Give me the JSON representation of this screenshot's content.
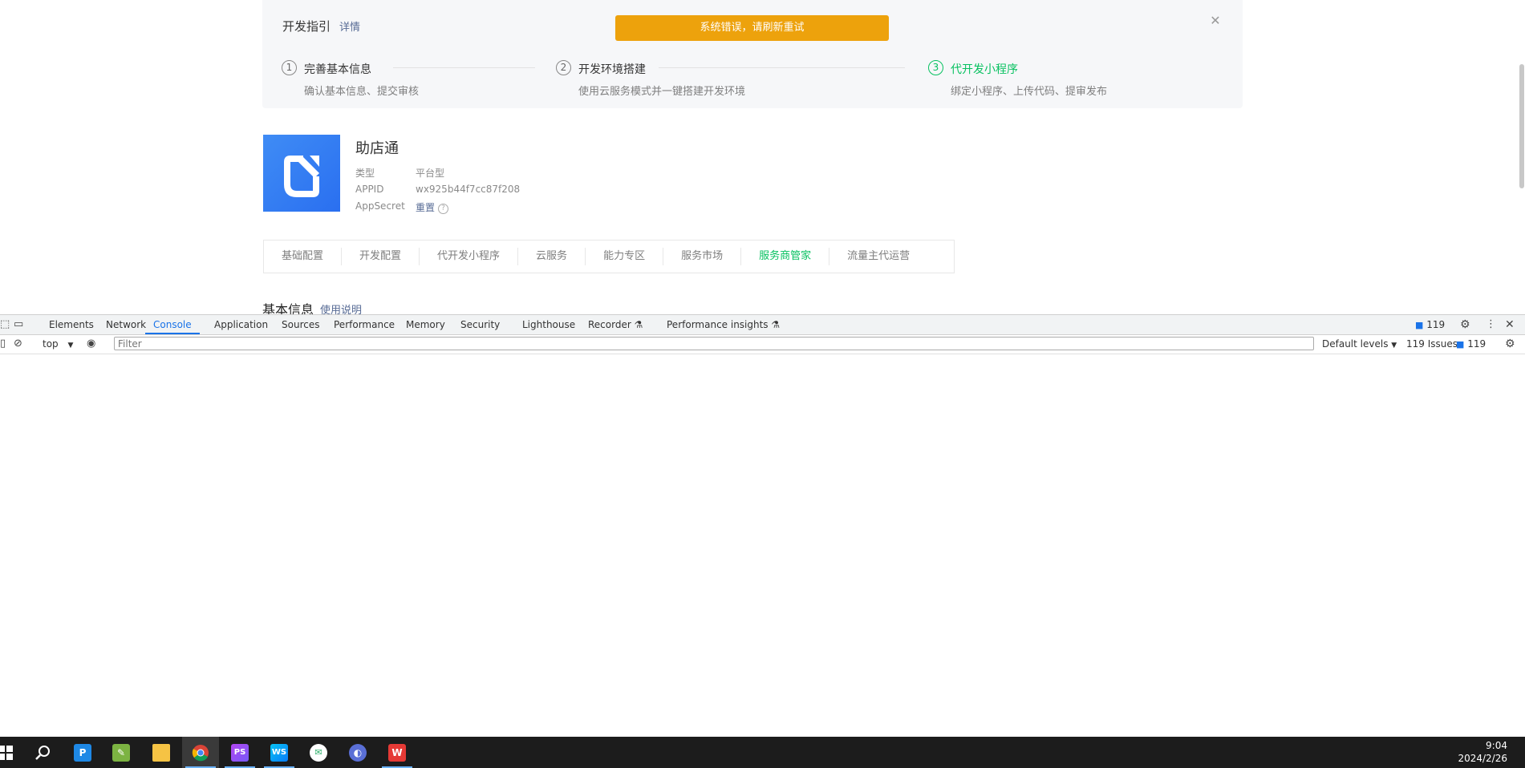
{
  "guide": {
    "title": "开发指引",
    "detail_link": "详情",
    "error_toast": "系统错误，请刷新重试",
    "close_icon": "close-icon",
    "steps": [
      {
        "num": "1",
        "title": "完善基本信息",
        "desc": "确认基本信息、提交审核"
      },
      {
        "num": "2",
        "title": "开发环境搭建",
        "desc": "使用云服务模式并一键搭建开发环境"
      },
      {
        "num": "3",
        "title": "代开发小程序",
        "desc": "绑定小程序、上传代码、提审发布",
        "active": true
      }
    ]
  },
  "app": {
    "name": "助店通",
    "type_label": "类型",
    "type_value": "平台型",
    "appid_label": "APPID",
    "appid_value": "wx925b44f7cc87f208",
    "secret_label": "AppSecret",
    "secret_action": "重置",
    "help_icon": "?"
  },
  "tabs": [
    {
      "label": "基础配置"
    },
    {
      "label": "开发配置"
    },
    {
      "label": "代开发小程序"
    },
    {
      "label": "云服务"
    },
    {
      "label": "能力专区"
    },
    {
      "label": "服务市场"
    },
    {
      "label": "服务商管家",
      "active": true
    },
    {
      "label": "流量主代运营"
    }
  ],
  "section": {
    "title": "基本信息",
    "link": "使用说明"
  },
  "devtools": {
    "tabs": [
      "Elements",
      "Network",
      "Console",
      "Application",
      "Sources",
      "Performance",
      "Memory",
      "Security",
      "Lighthouse",
      "Recorder ⚗",
      "Performance insights ⚗"
    ],
    "active_tab": "Console",
    "issues_badge": "119",
    "context": "top",
    "filter_placeholder": "Filter",
    "levels": "Default levels",
    "issues_label": "119 Issues:",
    "issues_count": "119"
  },
  "taskbar": {
    "apps": [
      "windows-start-icon",
      "search-icon",
      "p-app-icon",
      "notepad-icon",
      "file-explorer-icon",
      "chrome-icon",
      "phpstorm-icon",
      "webstorm-icon",
      "wechat-icon",
      "dolphin-app-icon",
      "wps-icon"
    ],
    "time": "9:04",
    "date": "2024/2/26"
  },
  "colors": {
    "accent_green": "#07c160",
    "link_blue": "#576b95",
    "toast_orange": "#eda20c",
    "devtools_blue": "#1a73e8"
  }
}
